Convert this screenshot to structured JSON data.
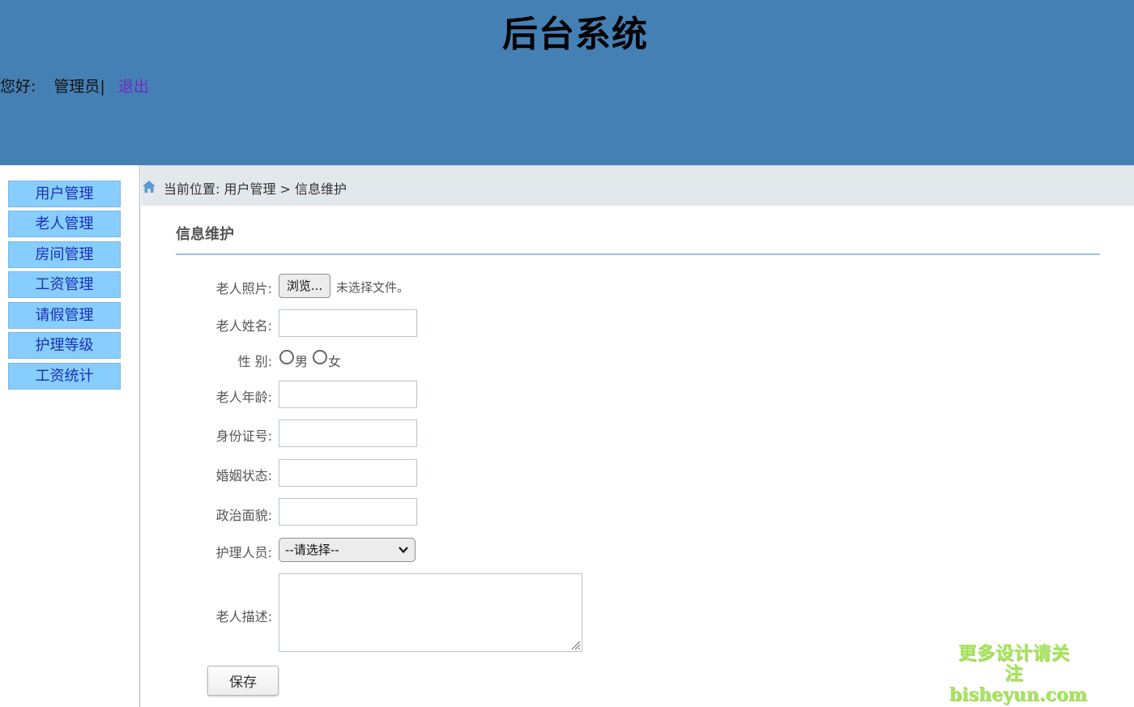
{
  "header": {
    "title": "后台系统",
    "greeting": "您好:",
    "username": "管理员|",
    "logout": "退出"
  },
  "sidebar": {
    "items": [
      {
        "label": "用户管理"
      },
      {
        "label": "老人管理"
      },
      {
        "label": "房间管理"
      },
      {
        "label": "工资管理"
      },
      {
        "label": "请假管理"
      },
      {
        "label": "护理等级"
      },
      {
        "label": "工资统计"
      }
    ]
  },
  "breadcrumb": {
    "icon": "home-icon",
    "text": "当前位置: 用户管理 > 信息维护"
  },
  "form": {
    "section_title": "信息维护",
    "photo": {
      "label": "老人照片:",
      "button": "浏览...",
      "status": "未选择文件。"
    },
    "name": {
      "label": "老人姓名:",
      "value": ""
    },
    "gender": {
      "label": "性 别:",
      "options": [
        "男",
        "女"
      ],
      "selected": null
    },
    "age": {
      "label": "老人年龄:",
      "value": ""
    },
    "id_number": {
      "label": "身份证号:",
      "value": ""
    },
    "marital": {
      "label": "婚姻状态:",
      "value": ""
    },
    "political": {
      "label": "政治面貌:",
      "value": ""
    },
    "caregiver": {
      "label": "护理人员:",
      "selected": "--请选择--"
    },
    "description": {
      "label": "老人描述:",
      "value": ""
    },
    "save_label": "保存"
  },
  "watermark": {
    "line1": "更多设计请关注",
    "line2": "bisheyun.com"
  },
  "colors": {
    "header_bg": "#4580b5",
    "menu_bg": "#87ceff",
    "menu_text": "#1a2fb5",
    "breadcrumb_bg": "#e3e8ec",
    "section_line": "#9cc3ea",
    "logout_link": "#6a2bbf"
  }
}
